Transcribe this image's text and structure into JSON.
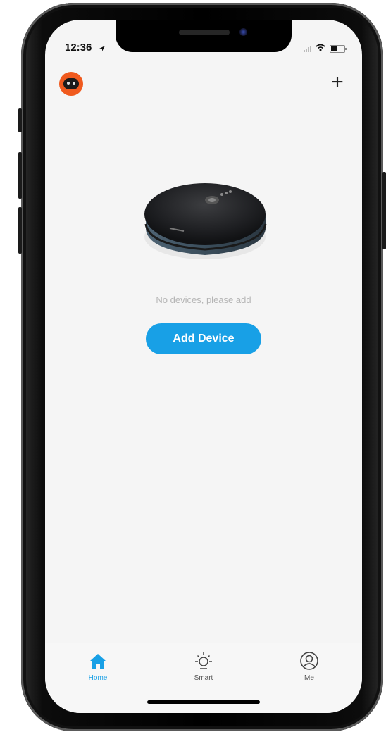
{
  "status_bar": {
    "time": "12:36"
  },
  "header": {
    "avatar_icon": "robot-avatar-icon",
    "add_icon": "plus-icon"
  },
  "main": {
    "empty_message": "No devices, please add",
    "add_device_label": "Add Device"
  },
  "tabs": [
    {
      "label": "Home",
      "icon": "home-icon",
      "active": true
    },
    {
      "label": "Smart",
      "icon": "sun-icon",
      "active": false
    },
    {
      "label": "Me",
      "icon": "user-icon",
      "active": false
    }
  ],
  "colors": {
    "accent": "#18a0e6",
    "avatar": "#f05a1e",
    "background": "#f5f5f5"
  }
}
